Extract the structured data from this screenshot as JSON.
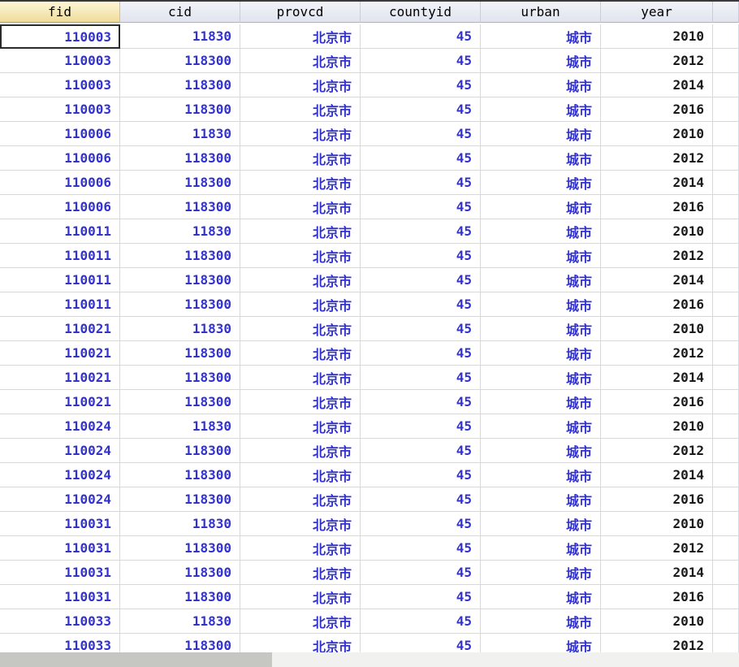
{
  "columns": [
    {
      "label": "fid",
      "value_color": "#3232cd",
      "selected": true
    },
    {
      "label": "cid",
      "value_color": "#3232cd",
      "selected": false
    },
    {
      "label": "provcd",
      "value_color": "#3232cd",
      "selected": false
    },
    {
      "label": "countyid",
      "value_color": "#3232cd",
      "selected": false
    },
    {
      "label": "urban",
      "value_color": "#3232cd",
      "selected": false
    },
    {
      "label": "year",
      "value_color": "#1a1a1a",
      "selected": false
    },
    {
      "label": "",
      "value_color": "#1a1a1a",
      "selected": false
    }
  ],
  "rows": [
    [
      "110003",
      "11830",
      "北京市",
      "45",
      "城市",
      "2010"
    ],
    [
      "110003",
      "118300",
      "北京市",
      "45",
      "城市",
      "2012"
    ],
    [
      "110003",
      "118300",
      "北京市",
      "45",
      "城市",
      "2014"
    ],
    [
      "110003",
      "118300",
      "北京市",
      "45",
      "城市",
      "2016"
    ],
    [
      "110006",
      "11830",
      "北京市",
      "45",
      "城市",
      "2010"
    ],
    [
      "110006",
      "118300",
      "北京市",
      "45",
      "城市",
      "2012"
    ],
    [
      "110006",
      "118300",
      "北京市",
      "45",
      "城市",
      "2014"
    ],
    [
      "110006",
      "118300",
      "北京市",
      "45",
      "城市",
      "2016"
    ],
    [
      "110011",
      "11830",
      "北京市",
      "45",
      "城市",
      "2010"
    ],
    [
      "110011",
      "118300",
      "北京市",
      "45",
      "城市",
      "2012"
    ],
    [
      "110011",
      "118300",
      "北京市",
      "45",
      "城市",
      "2014"
    ],
    [
      "110011",
      "118300",
      "北京市",
      "45",
      "城市",
      "2016"
    ],
    [
      "110021",
      "11830",
      "北京市",
      "45",
      "城市",
      "2010"
    ],
    [
      "110021",
      "118300",
      "北京市",
      "45",
      "城市",
      "2012"
    ],
    [
      "110021",
      "118300",
      "北京市",
      "45",
      "城市",
      "2014"
    ],
    [
      "110021",
      "118300",
      "北京市",
      "45",
      "城市",
      "2016"
    ],
    [
      "110024",
      "11830",
      "北京市",
      "45",
      "城市",
      "2010"
    ],
    [
      "110024",
      "118300",
      "北京市",
      "45",
      "城市",
      "2012"
    ],
    [
      "110024",
      "118300",
      "北京市",
      "45",
      "城市",
      "2014"
    ],
    [
      "110024",
      "118300",
      "北京市",
      "45",
      "城市",
      "2016"
    ],
    [
      "110031",
      "11830",
      "北京市",
      "45",
      "城市",
      "2010"
    ],
    [
      "110031",
      "118300",
      "北京市",
      "45",
      "城市",
      "2012"
    ],
    [
      "110031",
      "118300",
      "北京市",
      "45",
      "城市",
      "2014"
    ],
    [
      "110031",
      "118300",
      "北京市",
      "45",
      "城市",
      "2016"
    ],
    [
      "110033",
      "11830",
      "北京市",
      "45",
      "城市",
      "2010"
    ],
    [
      "110033",
      "118300",
      "北京市",
      "45",
      "城市",
      "2012"
    ]
  ],
  "selection": {
    "row_index": 0,
    "col_index": 0
  },
  "colors": {
    "selected_header_bg_top": "#fdf7d8",
    "selected_header_bg_bottom": "#f0dc9a",
    "header_bg_top": "#f2f4f9",
    "header_bg_bottom": "#e1e4ee",
    "value_text_blue": "#3232cd",
    "value_text_black": "#1a1a1a",
    "grid_line": "#d4d8e4",
    "selected_cell_border": "#2b2b2b",
    "scrollbar_thumb": "#c6c6c3",
    "scrollbar_track": "#f1f1ef"
  }
}
